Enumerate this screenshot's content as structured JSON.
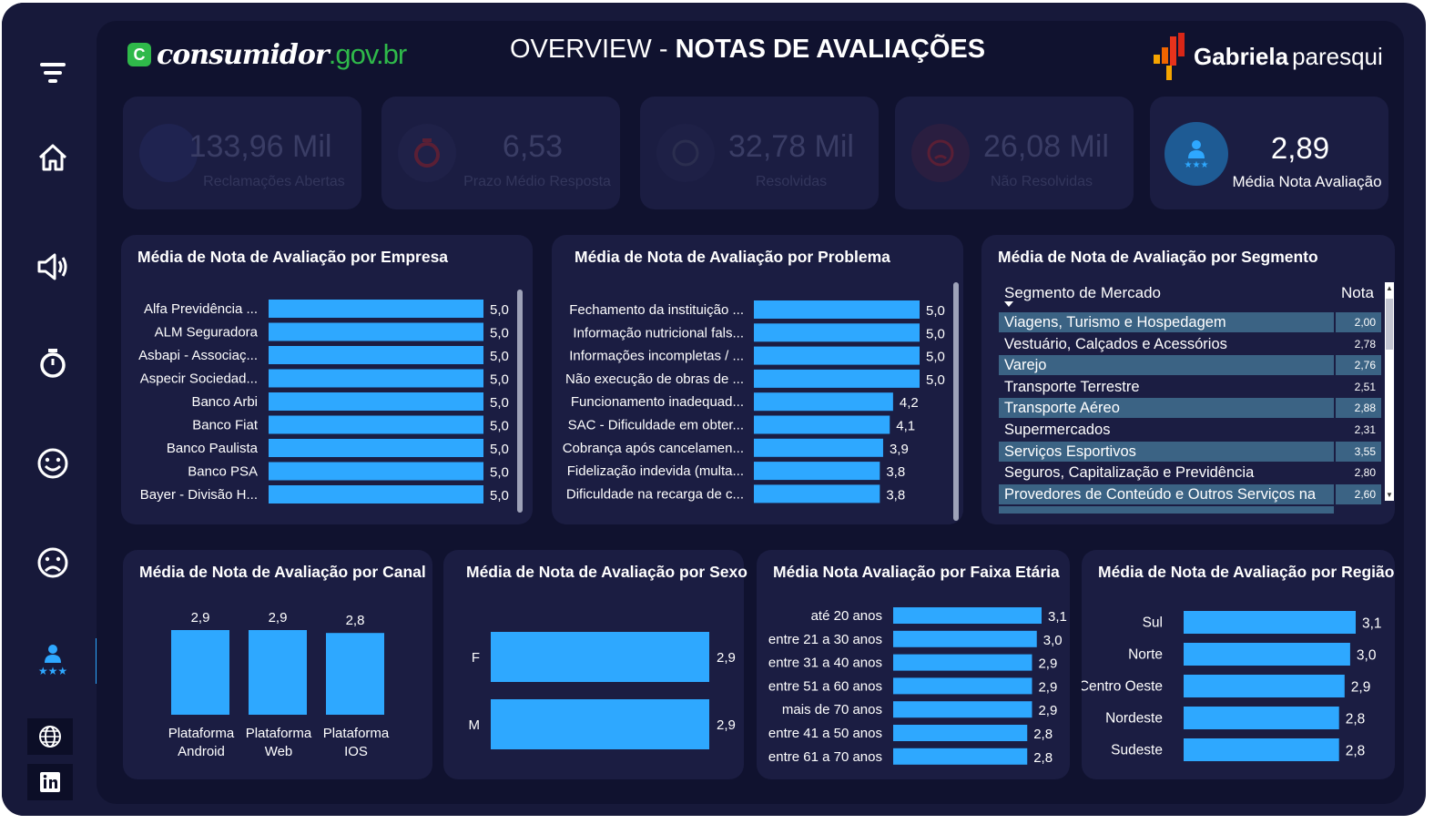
{
  "header": {
    "logo_left_part1": "consumidor",
    "logo_left_part2": ".gov.br",
    "logo_left_badge": "C",
    "title_light": "OVERVIEW - ",
    "title_bold": "NOTAS DE AVALIAÇÕES",
    "logo_right_part1": "Gabriela",
    "logo_right_part2": "paresqui"
  },
  "sidebar": {
    "items": [
      {
        "name": "filter-icon"
      },
      {
        "name": "home-icon"
      },
      {
        "name": "megaphone-icon"
      },
      {
        "name": "stopwatch-icon"
      },
      {
        "name": "smile-icon"
      },
      {
        "name": "frown-icon"
      },
      {
        "name": "user-stars-icon"
      },
      {
        "name": "globe-icon"
      },
      {
        "name": "linkedin-icon"
      }
    ],
    "active": "user-stars-icon"
  },
  "kpis": [
    {
      "value": "133,96 Mil",
      "label": "Reclamações Abertas",
      "icon": "chart-icon",
      "dim": true
    },
    {
      "value": "6,53",
      "label": "Prazo Médio Resposta",
      "icon": "stopwatch-icon",
      "dim": true
    },
    {
      "value": "32,78 Mil",
      "label": "Resolvidas",
      "icon": "smile-icon",
      "dim": true
    },
    {
      "value": "26,08 Mil",
      "label": "Não Resolvidas",
      "icon": "frown-icon",
      "dim": true
    },
    {
      "value": "2,89",
      "label": "Média Nota Avaliação",
      "icon": "user-stars-icon",
      "dim": false
    }
  ],
  "cards": {
    "empresa_title": "Média de Nota de Avaliação por Empresa",
    "problema_title": "Média de Nota de Avaliação por Problema",
    "segmento_title": "Média de Nota de Avaliação por Segmento",
    "canal_title": "Média de Nota de Avaliação por Canal",
    "sexo_title": "Média de Nota de Avaliação por Sexo",
    "faixa_title": "Média Nota Avaliação por Faixa Etária",
    "regiao_title": "Média de Nota de Avaliação por Região"
  },
  "segment_table": {
    "col1": "Segmento de Mercado",
    "col2": "Nota",
    "rows": [
      {
        "segment": "Viagens, Turismo e Hospedagem",
        "nota": "2,00"
      },
      {
        "segment": "Vestuário, Calçados e Acessórios",
        "nota": "2,78"
      },
      {
        "segment": "Varejo",
        "nota": "2,76"
      },
      {
        "segment": "Transporte Terrestre",
        "nota": "2,51"
      },
      {
        "segment": "Transporte Aéreo",
        "nota": "2,88"
      },
      {
        "segment": "Supermercados",
        "nota": "2,31"
      },
      {
        "segment": "Serviços Esportivos",
        "nota": "3,55"
      },
      {
        "segment": "Seguros, Capitalização e Previdência",
        "nota": "2,80"
      },
      {
        "segment": "Provedores de Conteúdo e Outros Serviços na",
        "nota": "2,60"
      }
    ]
  },
  "colors": {
    "bar": "#2ea8ff",
    "panel": "#1b1d42",
    "background": "#10122f",
    "highlight_row": "#3b6384"
  },
  "chart_data": [
    {
      "type": "bar",
      "orientation": "horizontal",
      "categories": [
        "Alfa Previdência ...",
        "ALM Seguradora",
        "Asbapi - Associaç...",
        "Aspecir Sociedad...",
        "Banco Arbi",
        "Banco Fiat",
        "Banco Paulista",
        "Banco PSA",
        "Bayer - Divisão H..."
      ],
      "values": [
        5.0,
        5.0,
        5.0,
        5.0,
        5.0,
        5.0,
        5.0,
        5.0,
        5.0
      ],
      "labels": [
        "5,0",
        "5,0",
        "5,0",
        "5,0",
        "5,0",
        "5,0",
        "5,0",
        "5,0",
        "5,0"
      ],
      "title": "Média de Nota de Avaliação por Empresa"
    },
    {
      "type": "bar",
      "orientation": "horizontal",
      "categories": [
        "Fechamento da instituição ...",
        "Informação nutricional fals...",
        "Informações incompletas / ...",
        "Não execução de obras de ...",
        "Funcionamento inadequad...",
        "SAC - Dificuldade em obter...",
        "Cobrança após cancelamen...",
        "Fidelização indevida (multa...",
        "Dificuldade na recarga de c..."
      ],
      "values": [
        5.0,
        5.0,
        5.0,
        5.0,
        4.2,
        4.1,
        3.9,
        3.8,
        3.8
      ],
      "labels": [
        "5,0",
        "5,0",
        "5,0",
        "5,0",
        "4,2",
        "4,1",
        "3,9",
        "3,8",
        "3,8"
      ],
      "title": "Média de Nota de Avaliação por Problema"
    },
    {
      "type": "bar",
      "orientation": "vertical",
      "categories": [
        "Plataforma Android",
        "Plataforma Web",
        "Plataforma IOS"
      ],
      "values": [
        2.9,
        2.9,
        2.8
      ],
      "labels": [
        "2,9",
        "2,9",
        "2,8"
      ],
      "title": "Média de Nota de Avaliação por Canal"
    },
    {
      "type": "bar",
      "orientation": "horizontal",
      "categories": [
        "F",
        "M"
      ],
      "values": [
        2.9,
        2.9
      ],
      "labels": [
        "2,9",
        "2,9"
      ],
      "title": "Média de Nota de Avaliação por Sexo"
    },
    {
      "type": "bar",
      "orientation": "horizontal",
      "categories": [
        "até 20 anos",
        "entre 21 a 30 anos",
        "entre 31 a 40 anos",
        "entre 51 a 60 anos",
        "mais de 70 anos",
        "entre 41 a 50 anos",
        "entre 61 a 70 anos"
      ],
      "values": [
        3.1,
        3.0,
        2.9,
        2.9,
        2.9,
        2.8,
        2.8
      ],
      "labels": [
        "3,1",
        "3,0",
        "2,9",
        "2,9",
        "2,9",
        "2,8",
        "2,8"
      ],
      "title": "Média Nota Avaliação por Faixa Etária"
    },
    {
      "type": "bar",
      "orientation": "horizontal",
      "categories": [
        "Sul",
        "Norte",
        "Centro Oeste",
        "Nordeste",
        "Sudeste"
      ],
      "values": [
        3.1,
        3.0,
        2.9,
        2.8,
        2.8
      ],
      "labels": [
        "3,1",
        "3,0",
        "2,9",
        "2,8",
        "2,8"
      ],
      "title": "Média de Nota de Avaliação por Região"
    }
  ]
}
